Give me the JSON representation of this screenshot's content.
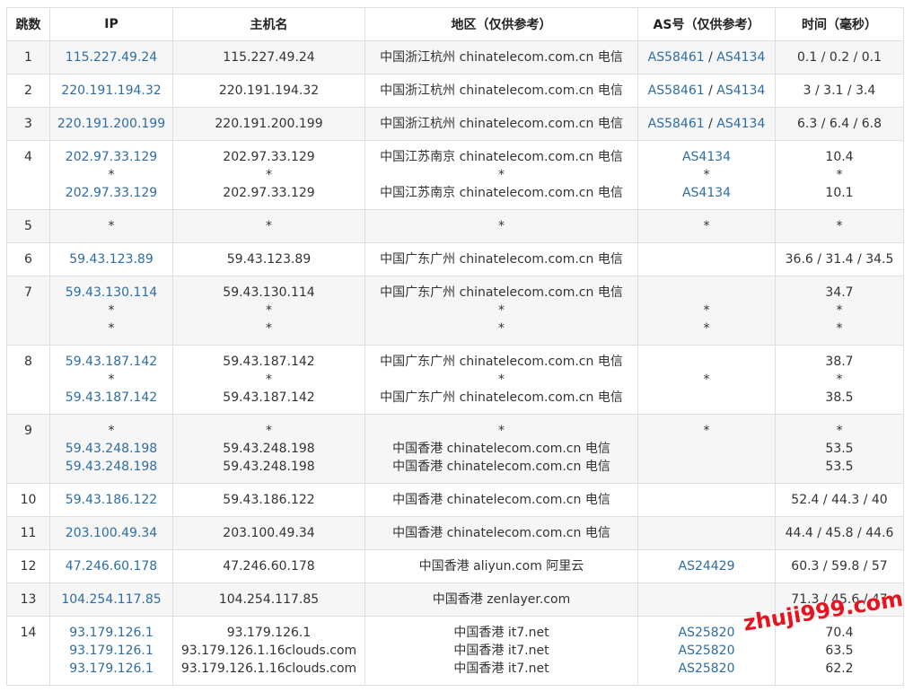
{
  "headers": {
    "hop": "跳数",
    "ip": "IP",
    "hostname": "主机名",
    "region": "地区（仅供参考）",
    "as": "AS号（仅供参考）",
    "time": "时间（毫秒）"
  },
  "rows": [
    {
      "hop": "1",
      "ip": [
        "115.227.49.24"
      ],
      "host": [
        "115.227.49.24"
      ],
      "region": [
        "中国浙江杭州 chinatelecom.com.cn 电信"
      ],
      "as": [
        [
          "AS58461",
          "AS4134"
        ]
      ],
      "time": [
        "0.1 / 0.2 / 0.1"
      ]
    },
    {
      "hop": "2",
      "ip": [
        "220.191.194.32"
      ],
      "host": [
        "220.191.194.32"
      ],
      "region": [
        "中国浙江杭州 chinatelecom.com.cn 电信"
      ],
      "as": [
        [
          "AS58461",
          "AS4134"
        ]
      ],
      "time": [
        "3 / 3.1 / 3.4"
      ]
    },
    {
      "hop": "3",
      "ip": [
        "220.191.200.199"
      ],
      "host": [
        "220.191.200.199"
      ],
      "region": [
        "中国浙江杭州 chinatelecom.com.cn 电信"
      ],
      "as": [
        [
          "AS58461",
          "AS4134"
        ]
      ],
      "time": [
        "6.3 / 6.4 / 6.8"
      ]
    },
    {
      "hop": "4",
      "ip": [
        "202.97.33.129",
        "*",
        "202.97.33.129"
      ],
      "host": [
        "202.97.33.129",
        "*",
        "202.97.33.129"
      ],
      "region": [
        "中国江苏南京 chinatelecom.com.cn 电信",
        "*",
        "中国江苏南京 chinatelecom.com.cn 电信"
      ],
      "as": [
        [
          "AS4134"
        ],
        [
          "*"
        ],
        [
          "AS4134"
        ]
      ],
      "time": [
        "10.4",
        "*",
        "10.1"
      ]
    },
    {
      "hop": "5",
      "ip": [
        "*"
      ],
      "host": [
        "*"
      ],
      "region": [
        "*"
      ],
      "as": [
        [
          "*"
        ]
      ],
      "time": [
        "*"
      ]
    },
    {
      "hop": "6",
      "ip": [
        "59.43.123.89"
      ],
      "host": [
        "59.43.123.89"
      ],
      "region": [
        "中国广东广州 chinatelecom.com.cn 电信"
      ],
      "as": [
        [
          ""
        ]
      ],
      "time": [
        "36.6 / 31.4 / 34.5"
      ]
    },
    {
      "hop": "7",
      "ip": [
        "59.43.130.114",
        "*",
        "*"
      ],
      "host": [
        "59.43.130.114",
        "*",
        "*"
      ],
      "region": [
        "中国广东广州 chinatelecom.com.cn 电信",
        "*",
        "*"
      ],
      "as": [
        [
          ""
        ],
        [
          "*"
        ],
        [
          "*"
        ]
      ],
      "time": [
        "34.7",
        "*",
        "*"
      ]
    },
    {
      "hop": "8",
      "ip": [
        "59.43.187.142",
        "*",
        "59.43.187.142"
      ],
      "host": [
        "59.43.187.142",
        "*",
        "59.43.187.142"
      ],
      "region": [
        "中国广东广州 chinatelecom.com.cn 电信",
        "*",
        "中国广东广州 chinatelecom.com.cn 电信"
      ],
      "as": [
        [
          ""
        ],
        [
          "*"
        ],
        [
          ""
        ]
      ],
      "time": [
        "38.7",
        "*",
        "38.5"
      ]
    },
    {
      "hop": "9",
      "ip": [
        "*",
        "59.43.248.198",
        "59.43.248.198"
      ],
      "host": [
        "*",
        "59.43.248.198",
        "59.43.248.198"
      ],
      "region": [
        "*",
        "中国香港 chinatelecom.com.cn 电信",
        "中国香港 chinatelecom.com.cn 电信"
      ],
      "as": [
        [
          "*"
        ],
        [
          ""
        ],
        [
          ""
        ]
      ],
      "time": [
        "*",
        "53.5",
        "53.5"
      ]
    },
    {
      "hop": "10",
      "ip": [
        "59.43.186.122"
      ],
      "host": [
        "59.43.186.122"
      ],
      "region": [
        "中国香港 chinatelecom.com.cn 电信"
      ],
      "as": [
        [
          ""
        ]
      ],
      "time": [
        "52.4 / 44.3 / 40"
      ]
    },
    {
      "hop": "11",
      "ip": [
        "203.100.49.34"
      ],
      "host": [
        "203.100.49.34"
      ],
      "region": [
        "中国香港 chinatelecom.com.cn 电信"
      ],
      "as": [
        [
          ""
        ]
      ],
      "time": [
        "44.4 / 45.8 / 44.6"
      ]
    },
    {
      "hop": "12",
      "ip": [
        "47.246.60.178"
      ],
      "host": [
        "47.246.60.178"
      ],
      "region": [
        "中国香港 aliyun.com 阿里云"
      ],
      "as": [
        [
          "AS24429"
        ]
      ],
      "time": [
        "60.3 / 59.8 / 57"
      ]
    },
    {
      "hop": "13",
      "ip": [
        "104.254.117.85"
      ],
      "host": [
        "104.254.117.85"
      ],
      "region": [
        "中国香港 zenlayer.com"
      ],
      "as": [
        [
          ""
        ]
      ],
      "time": [
        "71.3 / 45.6 / 47"
      ]
    },
    {
      "hop": "14",
      "ip": [
        "93.179.126.1",
        "93.179.126.1",
        "93.179.126.1"
      ],
      "host": [
        "93.179.126.1",
        "93.179.126.1.16clouds.com",
        "93.179.126.1.16clouds.com"
      ],
      "region": [
        "中国香港 it7.net",
        "中国香港 it7.net",
        "中国香港 it7.net"
      ],
      "as": [
        [
          "AS25820"
        ],
        [
          "AS25820"
        ],
        [
          "AS25820"
        ]
      ],
      "time": [
        "70.4",
        "63.5",
        "62.2"
      ]
    }
  ],
  "as_separator": " / ",
  "watermark": "zhuji999.com",
  "colors": {
    "link": "#2d6da3",
    "border": "#dedede",
    "shade": "#f6f6f6",
    "watermark": "#e8131f"
  }
}
